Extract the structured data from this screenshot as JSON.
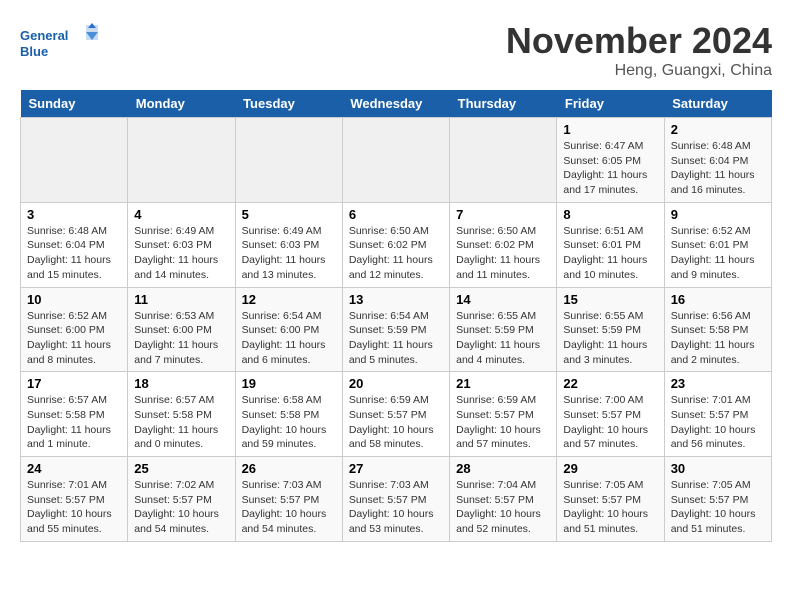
{
  "header": {
    "logo_text_general": "General",
    "logo_text_blue": "Blue",
    "month": "November 2024",
    "location": "Heng, Guangxi, China"
  },
  "weekdays": [
    "Sunday",
    "Monday",
    "Tuesday",
    "Wednesday",
    "Thursday",
    "Friday",
    "Saturday"
  ],
  "weeks": [
    [
      {
        "day": "",
        "info": ""
      },
      {
        "day": "",
        "info": ""
      },
      {
        "day": "",
        "info": ""
      },
      {
        "day": "",
        "info": ""
      },
      {
        "day": "",
        "info": ""
      },
      {
        "day": "1",
        "info": "Sunrise: 6:47 AM\nSunset: 6:05 PM\nDaylight: 11 hours and 17 minutes."
      },
      {
        "day": "2",
        "info": "Sunrise: 6:48 AM\nSunset: 6:04 PM\nDaylight: 11 hours and 16 minutes."
      }
    ],
    [
      {
        "day": "3",
        "info": "Sunrise: 6:48 AM\nSunset: 6:04 PM\nDaylight: 11 hours and 15 minutes."
      },
      {
        "day": "4",
        "info": "Sunrise: 6:49 AM\nSunset: 6:03 PM\nDaylight: 11 hours and 14 minutes."
      },
      {
        "day": "5",
        "info": "Sunrise: 6:49 AM\nSunset: 6:03 PM\nDaylight: 11 hours and 13 minutes."
      },
      {
        "day": "6",
        "info": "Sunrise: 6:50 AM\nSunset: 6:02 PM\nDaylight: 11 hours and 12 minutes."
      },
      {
        "day": "7",
        "info": "Sunrise: 6:50 AM\nSunset: 6:02 PM\nDaylight: 11 hours and 11 minutes."
      },
      {
        "day": "8",
        "info": "Sunrise: 6:51 AM\nSunset: 6:01 PM\nDaylight: 11 hours and 10 minutes."
      },
      {
        "day": "9",
        "info": "Sunrise: 6:52 AM\nSunset: 6:01 PM\nDaylight: 11 hours and 9 minutes."
      }
    ],
    [
      {
        "day": "10",
        "info": "Sunrise: 6:52 AM\nSunset: 6:00 PM\nDaylight: 11 hours and 8 minutes."
      },
      {
        "day": "11",
        "info": "Sunrise: 6:53 AM\nSunset: 6:00 PM\nDaylight: 11 hours and 7 minutes."
      },
      {
        "day": "12",
        "info": "Sunrise: 6:54 AM\nSunset: 6:00 PM\nDaylight: 11 hours and 6 minutes."
      },
      {
        "day": "13",
        "info": "Sunrise: 6:54 AM\nSunset: 5:59 PM\nDaylight: 11 hours and 5 minutes."
      },
      {
        "day": "14",
        "info": "Sunrise: 6:55 AM\nSunset: 5:59 PM\nDaylight: 11 hours and 4 minutes."
      },
      {
        "day": "15",
        "info": "Sunrise: 6:55 AM\nSunset: 5:59 PM\nDaylight: 11 hours and 3 minutes."
      },
      {
        "day": "16",
        "info": "Sunrise: 6:56 AM\nSunset: 5:58 PM\nDaylight: 11 hours and 2 minutes."
      }
    ],
    [
      {
        "day": "17",
        "info": "Sunrise: 6:57 AM\nSunset: 5:58 PM\nDaylight: 11 hours and 1 minute."
      },
      {
        "day": "18",
        "info": "Sunrise: 6:57 AM\nSunset: 5:58 PM\nDaylight: 11 hours and 0 minutes."
      },
      {
        "day": "19",
        "info": "Sunrise: 6:58 AM\nSunset: 5:58 PM\nDaylight: 10 hours and 59 minutes."
      },
      {
        "day": "20",
        "info": "Sunrise: 6:59 AM\nSunset: 5:57 PM\nDaylight: 10 hours and 58 minutes."
      },
      {
        "day": "21",
        "info": "Sunrise: 6:59 AM\nSunset: 5:57 PM\nDaylight: 10 hours and 57 minutes."
      },
      {
        "day": "22",
        "info": "Sunrise: 7:00 AM\nSunset: 5:57 PM\nDaylight: 10 hours and 57 minutes."
      },
      {
        "day": "23",
        "info": "Sunrise: 7:01 AM\nSunset: 5:57 PM\nDaylight: 10 hours and 56 minutes."
      }
    ],
    [
      {
        "day": "24",
        "info": "Sunrise: 7:01 AM\nSunset: 5:57 PM\nDaylight: 10 hours and 55 minutes."
      },
      {
        "day": "25",
        "info": "Sunrise: 7:02 AM\nSunset: 5:57 PM\nDaylight: 10 hours and 54 minutes."
      },
      {
        "day": "26",
        "info": "Sunrise: 7:03 AM\nSunset: 5:57 PM\nDaylight: 10 hours and 54 minutes."
      },
      {
        "day": "27",
        "info": "Sunrise: 7:03 AM\nSunset: 5:57 PM\nDaylight: 10 hours and 53 minutes."
      },
      {
        "day": "28",
        "info": "Sunrise: 7:04 AM\nSunset: 5:57 PM\nDaylight: 10 hours and 52 minutes."
      },
      {
        "day": "29",
        "info": "Sunrise: 7:05 AM\nSunset: 5:57 PM\nDaylight: 10 hours and 51 minutes."
      },
      {
        "day": "30",
        "info": "Sunrise: 7:05 AM\nSunset: 5:57 PM\nDaylight: 10 hours and 51 minutes."
      }
    ]
  ]
}
